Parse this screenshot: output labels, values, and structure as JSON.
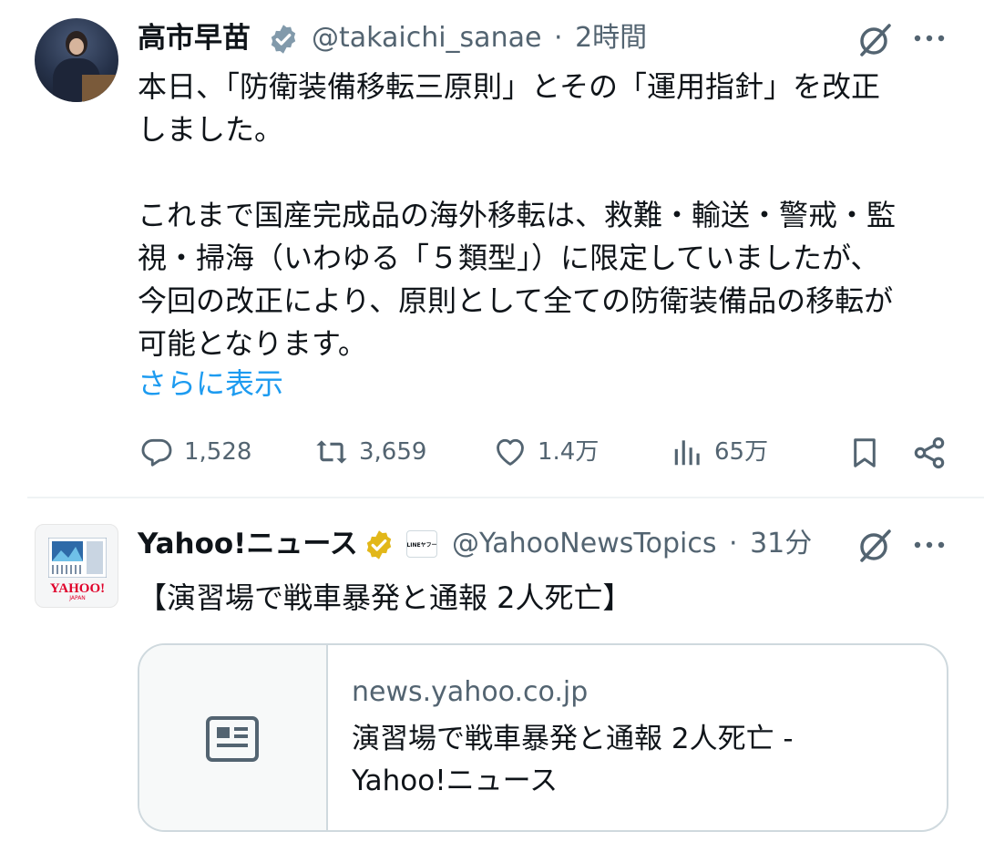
{
  "tweet1": {
    "name": "高市早苗",
    "handle": "@takaichi_sanae",
    "separator": "·",
    "time": "2時間",
    "lines": [
      "本日、「防衛装備移転三原則」とその「運用指針」を改正",
      "しました。",
      "これまで国産完成品の海外移転は、救難・輸送・警戒・監",
      "視・掃海（いわゆる「５類型」）に限定していましたが、",
      "今回の改正により、原則として全ての防衛装備品の移転が",
      "可能となります。"
    ],
    "show_more": "さらに表示",
    "replies": "1,528",
    "retweets": "3,659",
    "likes": "1.4万",
    "views": "65万",
    "verified_color": "#829aab"
  },
  "tweet2": {
    "name": "Yahoo!ニュース",
    "badge_label": "LINEヤフー",
    "handle": "@YahooNewsTopics",
    "separator": "·",
    "time": "31分",
    "text": "【演習場で戦車暴発と通報 2人死亡】",
    "avatar_logo": "YAHOO!",
    "avatar_sub": "JAPAN",
    "verified_color": "#e2b719",
    "card": {
      "domain": "news.yahoo.co.jp",
      "title_line1": "演習場で戦車暴発と通報 2人死亡 -",
      "title_line2": "Yahoo!ニュース"
    }
  },
  "colors": {
    "text": "#0f1419",
    "secondary": "#536471",
    "link": "#1d9bf0",
    "border": "#cfd9de"
  }
}
